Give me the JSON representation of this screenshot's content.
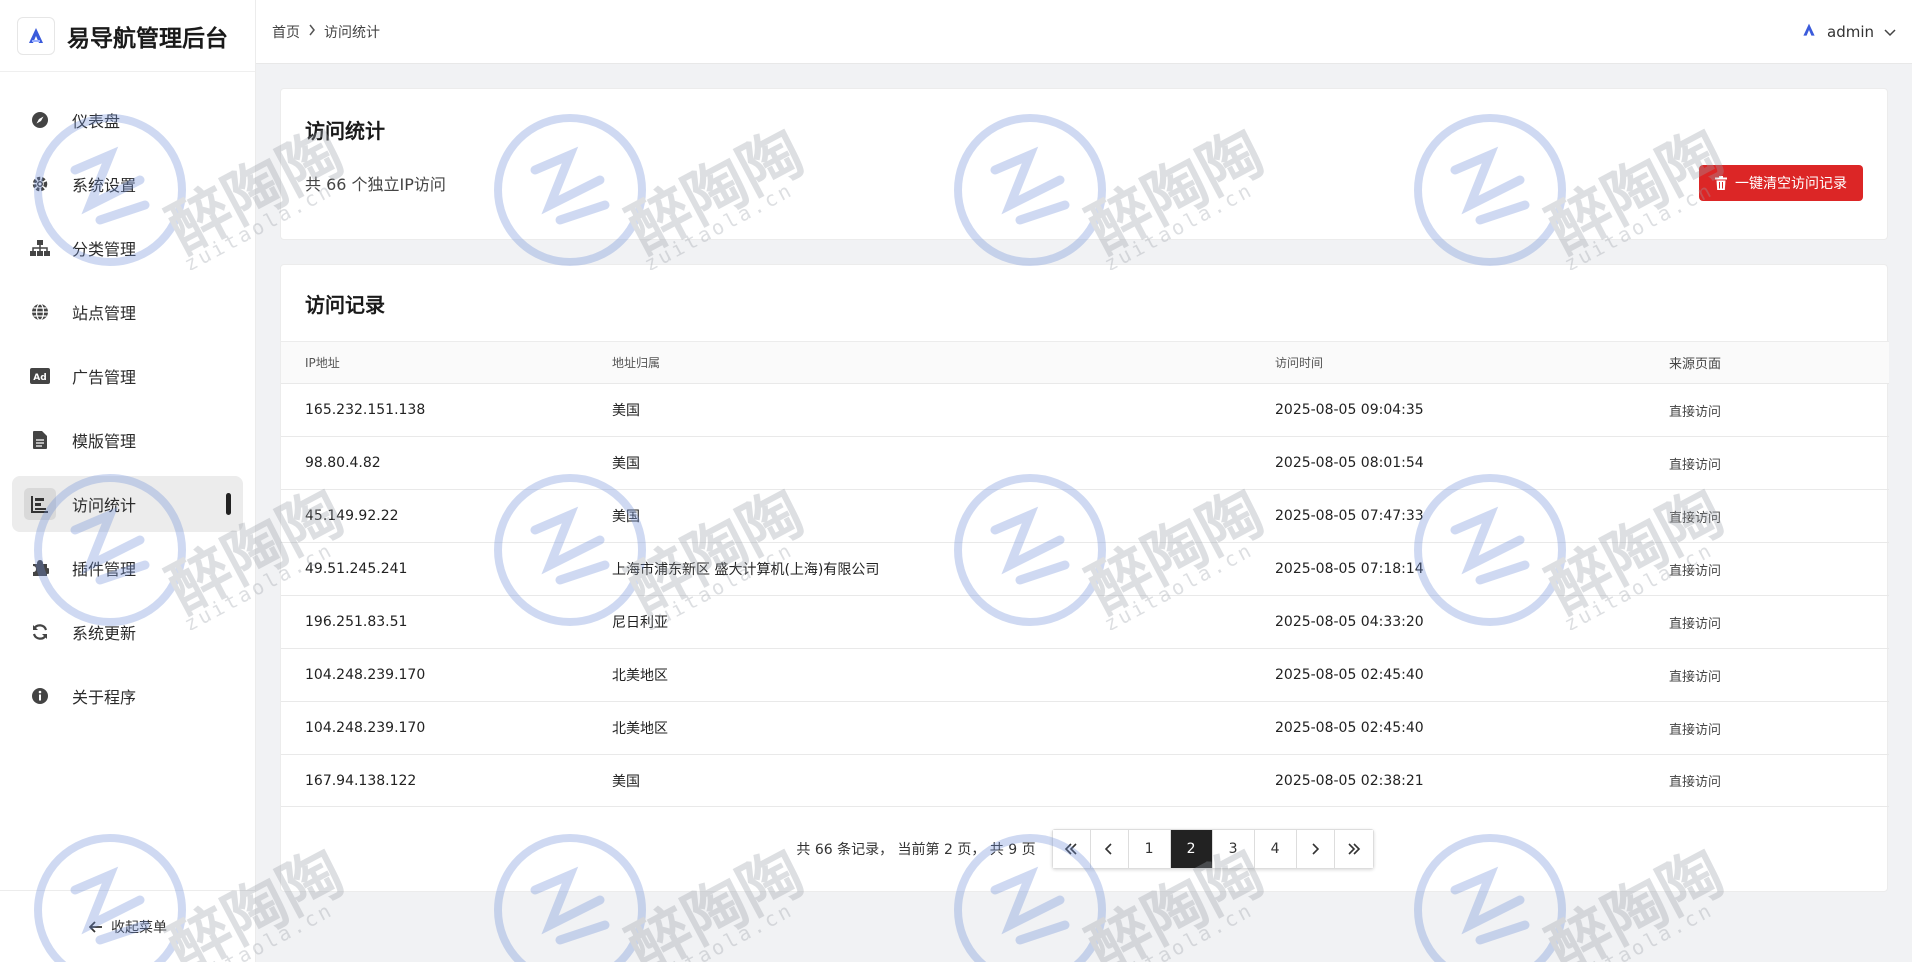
{
  "app": {
    "title": "易导航管理后台"
  },
  "sidebar": {
    "items": [
      {
        "label": "仪表盘",
        "icon": "compass-icon"
      },
      {
        "label": "系统设置",
        "icon": "gear-icon"
      },
      {
        "label": "分类管理",
        "icon": "sitemap-icon"
      },
      {
        "label": "站点管理",
        "icon": "globe-icon"
      },
      {
        "label": "广告管理",
        "icon": "ad-icon"
      },
      {
        "label": "模版管理",
        "icon": "file-icon"
      },
      {
        "label": "访问统计",
        "icon": "chart-icon",
        "active": true
      },
      {
        "label": "插件管理",
        "icon": "puzzle-icon"
      },
      {
        "label": "系统更新",
        "icon": "refresh-icon"
      },
      {
        "label": "关于程序",
        "icon": "info-icon"
      }
    ],
    "collapse_label": "收起菜单"
  },
  "header": {
    "breadcrumb": [
      "首页",
      "访问统计"
    ],
    "user": "admin"
  },
  "stats": {
    "title": "访问统计",
    "summary": "共 66 个独立IP访问",
    "clear_button": "一键清空访问记录"
  },
  "records": {
    "title": "访问记录",
    "columns": [
      "IP地址",
      "地址归属",
      "访问时间",
      "来源页面"
    ],
    "rows": [
      [
        "165.232.151.138",
        "美国",
        "2025-08-05 09:04:35",
        "直接访问"
      ],
      [
        "98.80.4.82",
        "美国",
        "2025-08-05 08:01:54",
        "直接访问"
      ],
      [
        "45.149.92.22",
        "美国",
        "2025-08-05 07:47:33",
        "直接访问"
      ],
      [
        "49.51.245.241",
        "上海市浦东新区 盛大计算机(上海)有限公司",
        "2025-08-05 07:18:14",
        "直接访问"
      ],
      [
        "196.251.83.51",
        "尼日利亚",
        "2025-08-05 04:33:20",
        "直接访问"
      ],
      [
        "104.248.239.170",
        "北美地区",
        "2025-08-05 02:45:40",
        "直接访问"
      ],
      [
        "104.248.239.170",
        "北美地区",
        "2025-08-05 02:45:40",
        "直接访问"
      ],
      [
        "167.94.138.122",
        "美国",
        "2025-08-05 02:38:21",
        "直接访问"
      ]
    ]
  },
  "pagination": {
    "info": "共 66 条记录， 当前第 2 页， 共 9 页",
    "pages": [
      "1",
      "2",
      "3",
      "4"
    ],
    "current": "2"
  },
  "watermark": {
    "text": "醉陶陶",
    "sub": "zuitaola.cn"
  },
  "colors": {
    "danger": "#dc2626",
    "active_page": "#222222"
  }
}
